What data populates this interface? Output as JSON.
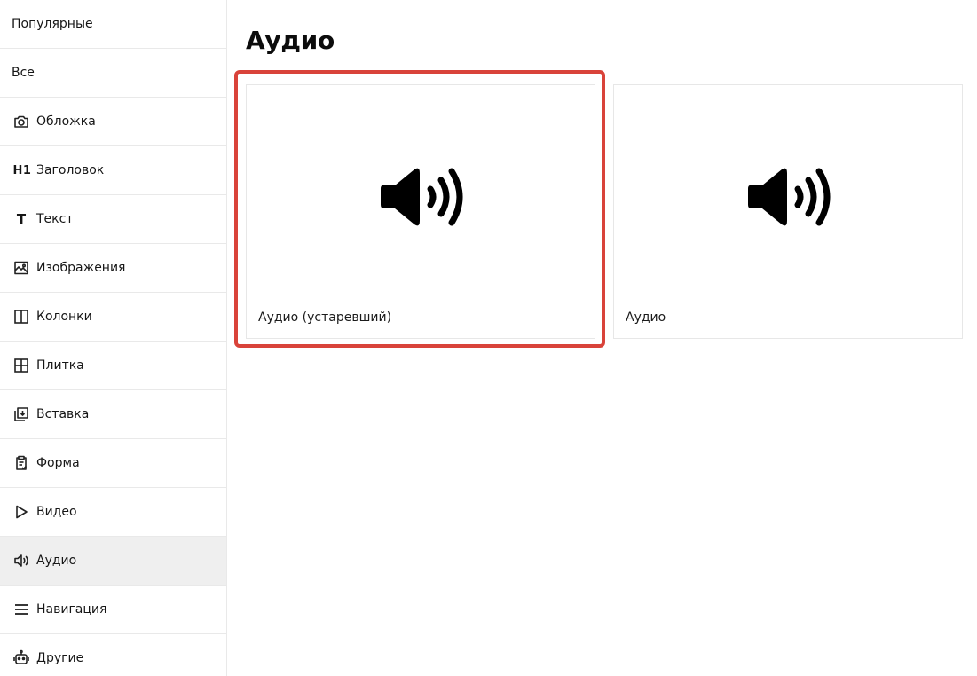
{
  "sidebar": {
    "items": [
      {
        "label": "Популярные",
        "icon": "none"
      },
      {
        "label": "Все",
        "icon": "none"
      },
      {
        "label": "Обложка",
        "icon": "camera-icon"
      },
      {
        "label": "Заголовок",
        "icon": "heading-icon",
        "icon_text": "H1"
      },
      {
        "label": "Текст",
        "icon": "text-icon",
        "icon_text": "T"
      },
      {
        "label": "Изображения",
        "icon": "image-icon"
      },
      {
        "label": "Колонки",
        "icon": "columns-icon"
      },
      {
        "label": "Плитка",
        "icon": "grid-icon"
      },
      {
        "label": "Вставка",
        "icon": "embed-icon"
      },
      {
        "label": "Форма",
        "icon": "clipboard-icon"
      },
      {
        "label": "Видео",
        "icon": "play-icon"
      },
      {
        "label": "Аудио",
        "icon": "speaker-icon",
        "active": true
      },
      {
        "label": "Навигация",
        "icon": "menu-icon"
      },
      {
        "label": "Другие",
        "icon": "robot-icon"
      }
    ]
  },
  "main": {
    "title": "Аудио",
    "cards": [
      {
        "label": "Аудио (устаревший)",
        "icon": "speaker-icon",
        "highlighted": true
      },
      {
        "label": "Аудио",
        "icon": "speaker-icon",
        "highlighted": false
      }
    ]
  },
  "colors": {
    "highlight": "#d9433a",
    "active_item_bg": "#efefef",
    "divider": "#e9e9e9"
  }
}
